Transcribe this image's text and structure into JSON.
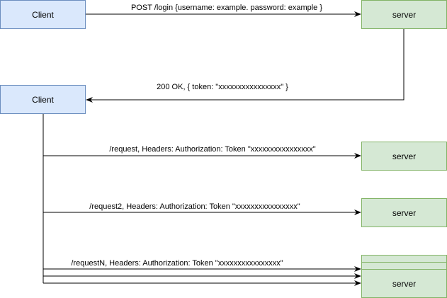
{
  "nodes": {
    "client_1": {
      "label": "Client",
      "fill": "#dae8fc",
      "stroke": "#6c8ebf"
    },
    "server_1": {
      "label": "server",
      "fill": "#d5e8d4",
      "stroke": "#82b366"
    },
    "client_2": {
      "label": "Client",
      "fill": "#dae8fc",
      "stroke": "#6c8ebf"
    },
    "server_2": {
      "label": "server",
      "fill": "#d5e8d4",
      "stroke": "#82b366"
    },
    "server_3": {
      "label": "server",
      "fill": "#d5e8d4",
      "stroke": "#82b366"
    },
    "server_4": {
      "label": "server",
      "fill": "#d5e8d4",
      "stroke": "#82b366"
    }
  },
  "edges": {
    "login": {
      "label": "POST /login {username: example. password: example }"
    },
    "token_response": {
      "label": "200 OK, { token: \"xxxxxxxxxxxxxxxx\" }"
    },
    "request_1": {
      "label": "/request, Headers: Authorization: Token \"xxxxxxxxxxxxxxxx\""
    },
    "request_2": {
      "label": "/request2, Headers: Authorization: Token \"xxxxxxxxxxxxxxxx\""
    },
    "request_n": {
      "label": "/requestN, Headers: Authorization: Token \"xxxxxxxxxxxxxxxx\""
    }
  },
  "colors": {
    "line": "#000000"
  }
}
